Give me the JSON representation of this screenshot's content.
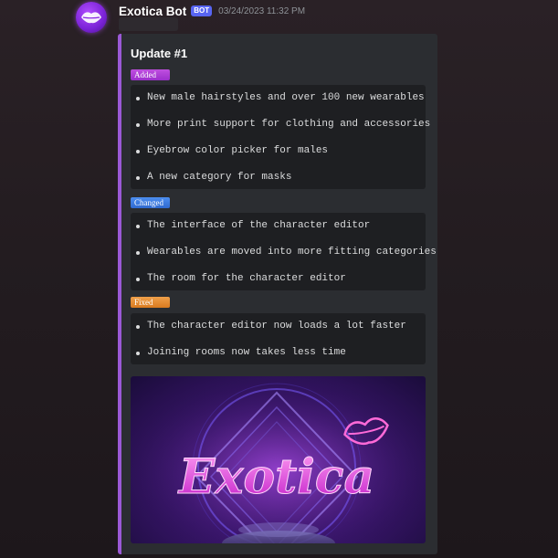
{
  "message": {
    "username": "Exotica Bot",
    "bot_tag": "BOT",
    "timestamp": "03/24/2023 11:32 PM"
  },
  "embed": {
    "accent_color": "#9b59d6",
    "title": "Update #1",
    "sections": {
      "added": {
        "tag": "Added",
        "tag_color": "#b43fd8",
        "items": [
          "New male hairstyles and over 100 new wearables",
          "More print support for clothing and accessories",
          "Eyebrow color picker for males",
          "A new category for masks"
        ]
      },
      "changed": {
        "tag": "Changed",
        "tag_color": "#3d7de0",
        "items": [
          "The interface of the character editor",
          "Wearables are moved into more fitting categories",
          "The room for the character editor"
        ]
      },
      "fixed": {
        "tag": "Fixed",
        "tag_color": "#e58c30",
        "items": [
          "The character editor now loads a lot faster",
          "Joining rooms now takes less time"
        ]
      }
    },
    "banner": {
      "logo_text": "Exotica",
      "icon": "lips-icon"
    }
  },
  "avatar": {
    "icon": "lips-icon"
  }
}
